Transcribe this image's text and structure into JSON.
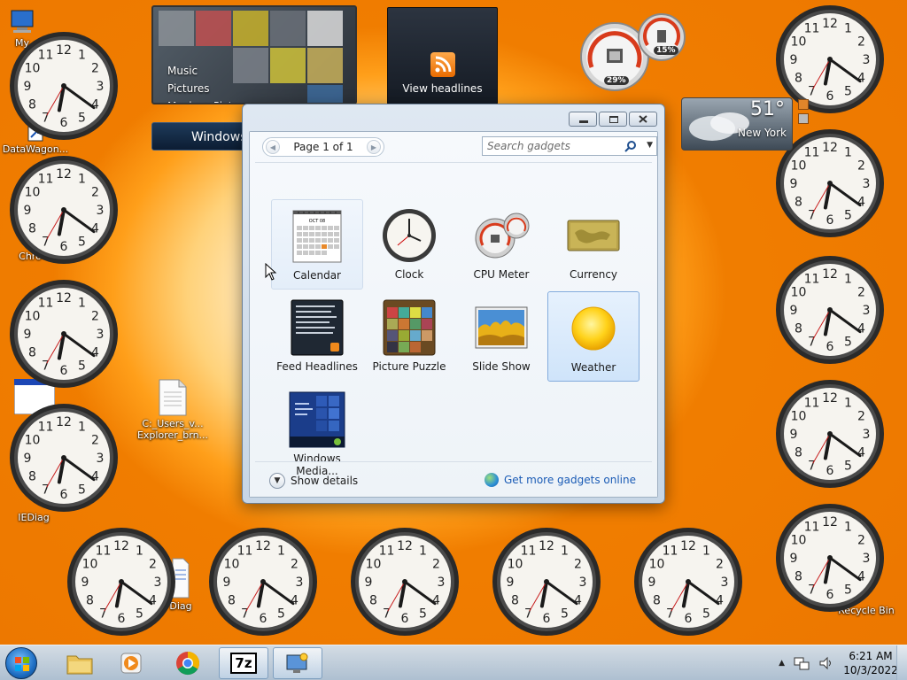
{
  "desktop": {
    "icons": [
      {
        "label": "My",
        "glyph": "computer-icon"
      },
      {
        "label": "DataWagon...",
        "glyph": "shortcut-icon"
      },
      {
        "label": "Chro",
        "glyph": "chrome-icon"
      },
      {
        "label": "C:_Users_v... Explorer_brn...",
        "glyph": "document-icon"
      },
      {
        "label": "IEDiag",
        "glyph": "folder-icon"
      },
      {
        "label": "Diag",
        "glyph": "document-icon"
      },
      {
        "label": "Recycle Bin",
        "glyph": "recycle-bin-icon"
      }
    ],
    "clocks_count": 14,
    "clock_time": "6:21"
  },
  "gadgets": {
    "media_center": {
      "menu": [
        "Music",
        "Pictures",
        "Music + Pictures"
      ],
      "bar_label": "Windows"
    },
    "feed_headlines": {
      "label": "View headlines"
    },
    "cpu_meter": {
      "cpu": "29%",
      "memory": "15%"
    },
    "weather": {
      "temperature": "51°",
      "city": "New York"
    }
  },
  "gallery_window": {
    "pager": {
      "label": "Page 1 of 1"
    },
    "search": {
      "placeholder": "Search gadgets"
    },
    "items": [
      {
        "label": "Calendar",
        "icon": "calendar-icon",
        "calendar_header": "OCT 08"
      },
      {
        "label": "Clock",
        "icon": "clock-icon"
      },
      {
        "label": "CPU Meter",
        "icon": "cpu-meter-icon"
      },
      {
        "label": "Currency",
        "icon": "currency-icon"
      },
      {
        "label": "Feed Headlines",
        "icon": "feed-headlines-icon"
      },
      {
        "label": "Picture Puzzle",
        "icon": "picture-puzzle-icon"
      },
      {
        "label": "Slide Show",
        "icon": "slide-show-icon"
      },
      {
        "label": "Weather",
        "icon": "weather-icon"
      },
      {
        "label": "Windows Media...",
        "icon": "windows-media-center-icon"
      }
    ],
    "footer": {
      "details_label": "Show details",
      "online_label": "Get more gadgets online"
    }
  },
  "taskbar": {
    "apps": [
      {
        "name": "windows-explorer"
      },
      {
        "name": "media-player"
      },
      {
        "name": "chrome"
      },
      {
        "name": "7-zip",
        "label": "7z"
      },
      {
        "name": "desktop-gadgets"
      }
    ],
    "time": "6:21 AM",
    "date": "10/3/2022"
  },
  "colors": {
    "wallpaper_orange": "#f07d00",
    "link_blue": "#1a5bb5",
    "selected_blue": "#cfe4fa"
  }
}
